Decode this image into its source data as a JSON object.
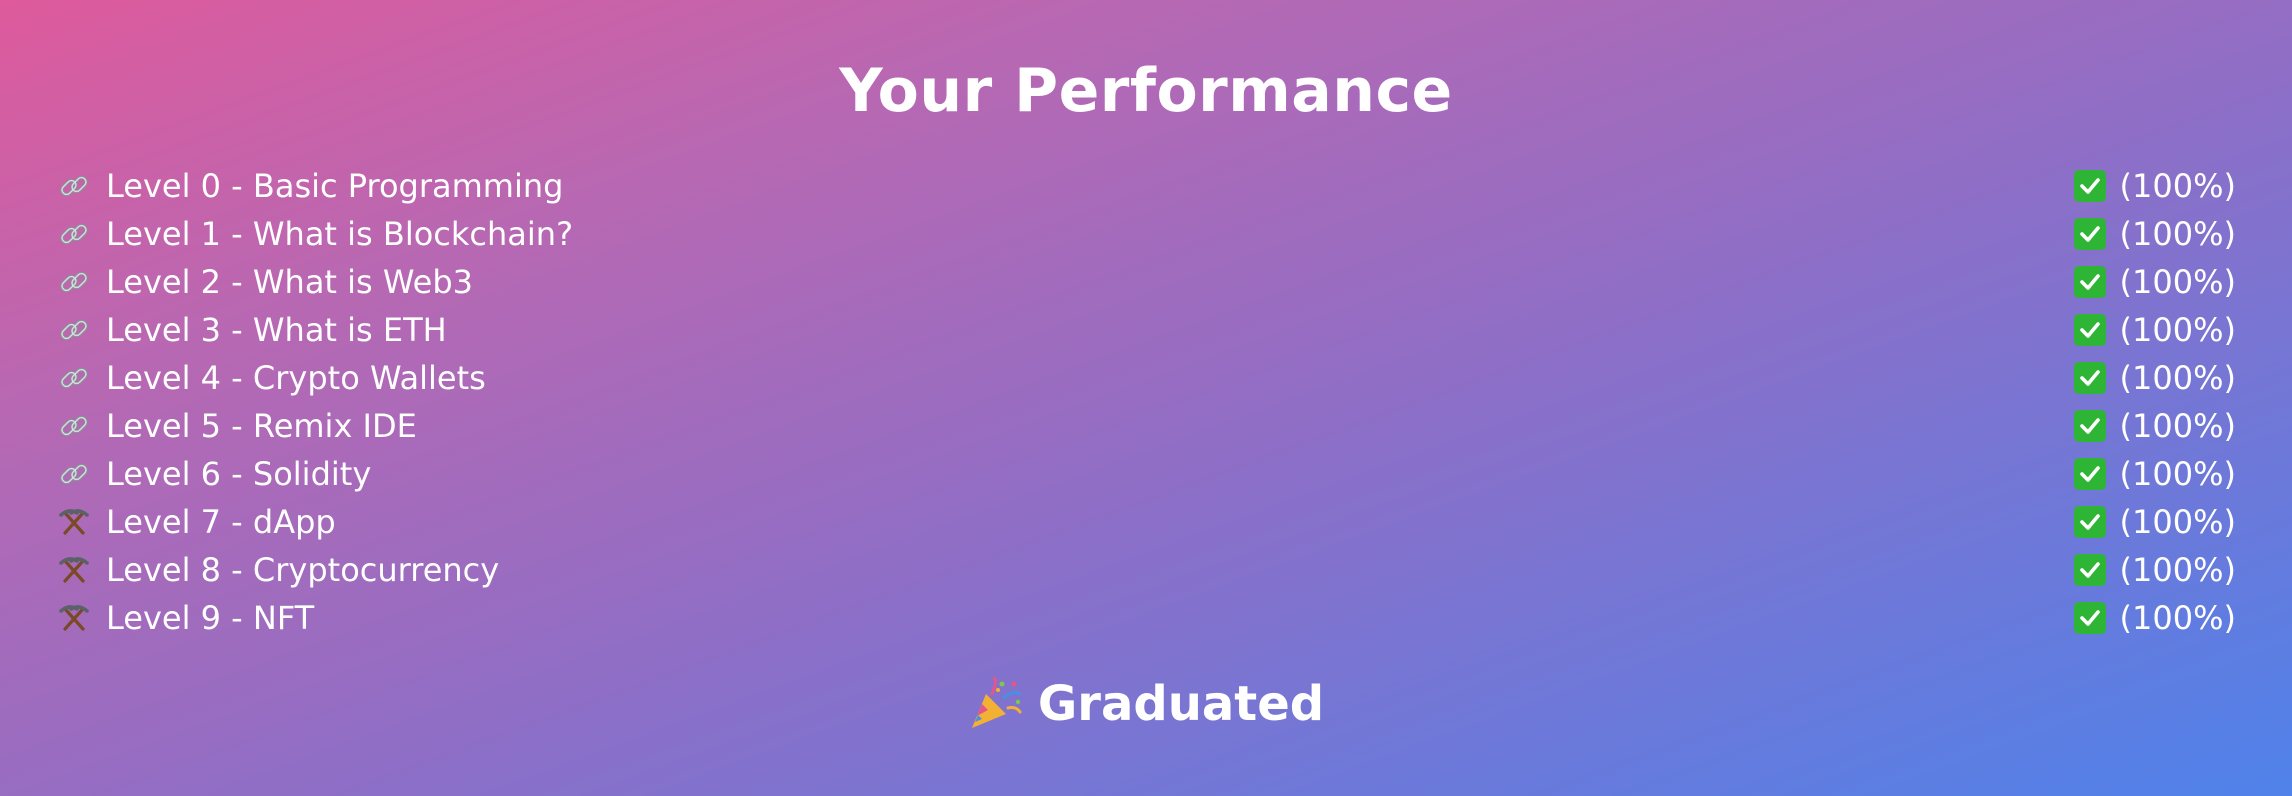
{
  "header": {
    "title": "Your Performance"
  },
  "levels": [
    {
      "icon": "link-icon",
      "label": "Level 0 - Basic Programming",
      "status_icon": "check-mark-icon",
      "score": "(100%)"
    },
    {
      "icon": "link-icon",
      "label": "Level 1 - What is Blockchain?",
      "status_icon": "check-mark-icon",
      "score": "(100%)"
    },
    {
      "icon": "link-icon",
      "label": "Level 2 - What is Web3",
      "status_icon": "check-mark-icon",
      "score": "(100%)"
    },
    {
      "icon": "link-icon",
      "label": "Level 3 - What is ETH",
      "status_icon": "check-mark-icon",
      "score": "(100%)"
    },
    {
      "icon": "link-icon",
      "label": "Level 4 - Crypto Wallets",
      "status_icon": "check-mark-icon",
      "score": "(100%)"
    },
    {
      "icon": "link-icon",
      "label": "Level 5 - Remix IDE",
      "status_icon": "check-mark-icon",
      "score": "(100%)"
    },
    {
      "icon": "link-icon",
      "label": "Level 6 - Solidity",
      "status_icon": "check-mark-icon",
      "score": "(100%)"
    },
    {
      "icon": "pick-icon",
      "label": "Level 7 - dApp",
      "status_icon": "check-mark-icon",
      "score": "(100%)"
    },
    {
      "icon": "pick-icon",
      "label": "Level 8 - Cryptocurrency",
      "status_icon": "check-mark-icon",
      "score": "(100%)"
    },
    {
      "icon": "pick-icon",
      "label": "Level 9 - NFT",
      "status_icon": "check-mark-icon",
      "score": "(100%)"
    }
  ],
  "footer": {
    "icon": "party-popper-icon",
    "label": "Graduated"
  },
  "colors": {
    "gradient_start": "#de5a9c",
    "gradient_end": "#4f82ea",
    "check_green": "#2fb536",
    "text": "#ffffff"
  }
}
